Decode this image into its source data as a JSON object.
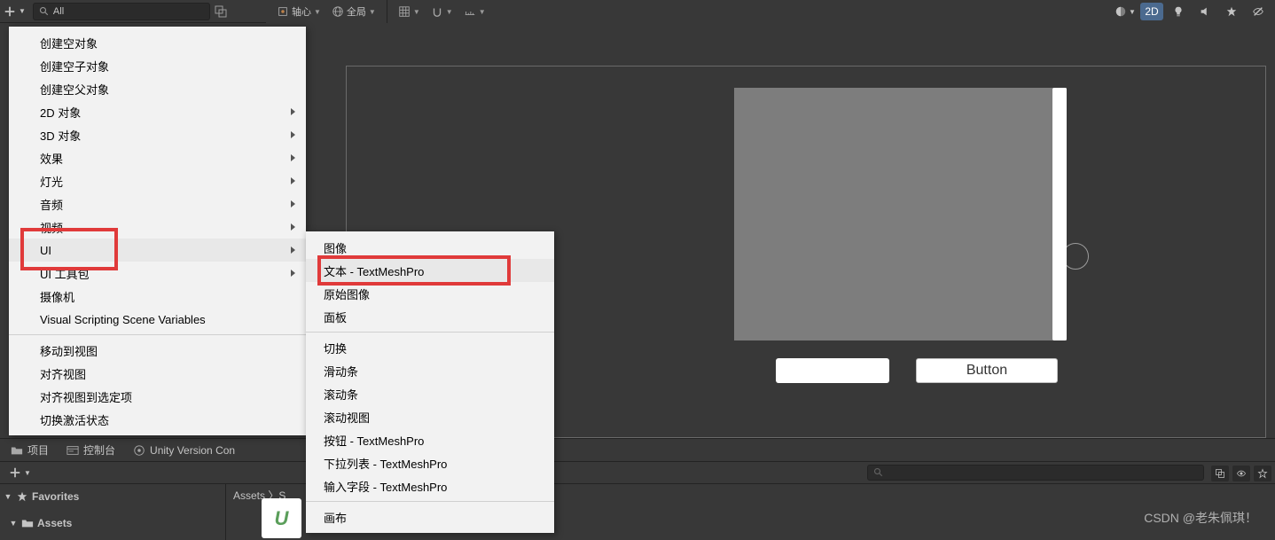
{
  "topbar": {
    "search_value": "All",
    "tool_pivot": "轴心",
    "tool_global": "全局",
    "btn_2d": "2D"
  },
  "context_menu": {
    "items": [
      {
        "label": "创建空对象",
        "sub": false
      },
      {
        "label": "创建空子对象",
        "sub": false
      },
      {
        "label": "创建空父对象",
        "sub": false
      },
      {
        "label": "2D 对象",
        "sub": true
      },
      {
        "label": "3D 对象",
        "sub": true
      },
      {
        "label": "效果",
        "sub": true
      },
      {
        "label": "灯光",
        "sub": true
      },
      {
        "label": "音频",
        "sub": true
      },
      {
        "label": "视频",
        "sub": true
      },
      {
        "label": "UI",
        "sub": true,
        "highlight": true
      },
      {
        "label": "UI 工具包",
        "sub": true
      },
      {
        "label": "摄像机",
        "sub": false
      },
      {
        "label": "Visual Scripting Scene Variables",
        "sub": false
      },
      {
        "label": "移动到视图",
        "sub": false,
        "sep_before": true
      },
      {
        "label": "对齐视图",
        "sub": false
      },
      {
        "label": "对齐视图到选定项",
        "sub": false
      },
      {
        "label": "切换激活状态",
        "sub": false
      }
    ]
  },
  "sub_menu": {
    "items": [
      {
        "label": "图像"
      },
      {
        "label": "文本 - TextMeshPro",
        "highlight": true
      },
      {
        "label": "原始图像"
      },
      {
        "label": "面板"
      },
      {
        "sep": true
      },
      {
        "label": "切换"
      },
      {
        "label": "滑动条"
      },
      {
        "label": "滚动条"
      },
      {
        "label": "滚动视图"
      },
      {
        "label": "按钮 - TextMeshPro"
      },
      {
        "label": "下拉列表 - TextMeshPro"
      },
      {
        "label": "输入字段 - TextMeshPro"
      },
      {
        "sep": true
      },
      {
        "label": "画布"
      }
    ]
  },
  "viewport": {
    "button_label": "Button"
  },
  "bottom": {
    "tab_project": "项目",
    "tab_console": "控制台",
    "tab_uvc": "Unity Version Con",
    "favorites": "Favorites",
    "assets": "Assets",
    "breadcrumb": "Assets  〉S"
  },
  "watermark": "CSDN @老朱佩琪！"
}
